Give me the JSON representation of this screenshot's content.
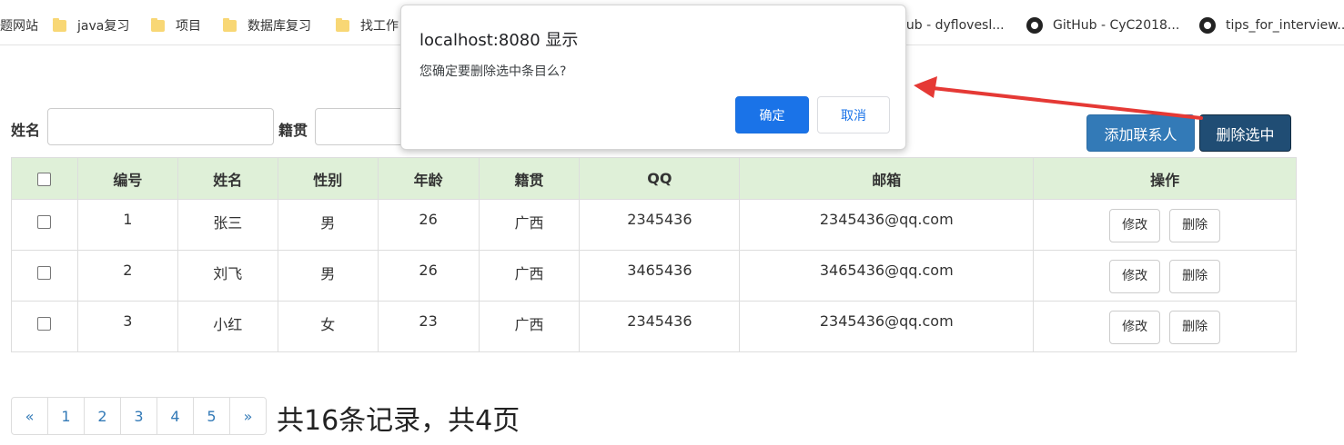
{
  "bookmarks": [
    {
      "label": "题网站",
      "icon": "none"
    },
    {
      "label": "java复习",
      "icon": "folder-icon"
    },
    {
      "label": "项目",
      "icon": "folder-icon"
    },
    {
      "label": "数据库复习",
      "icon": "folder-icon"
    },
    {
      "label": "找工作",
      "icon": "folder-icon"
    },
    {
      "label": "lub - dyflovesl...",
      "icon": "none"
    },
    {
      "label": "GitHub - CyC2018...",
      "icon": "github-icon"
    },
    {
      "label": "tips_for_interview...",
      "icon": "github-icon"
    }
  ],
  "search": {
    "name_label": "姓名",
    "native_label": "籍贯"
  },
  "actions": {
    "add_label": "添加联系人",
    "delete_selected_label": "删除选中"
  },
  "table": {
    "headers": [
      "编号",
      "姓名",
      "性别",
      "年龄",
      "籍贯",
      "QQ",
      "邮箱",
      "操作"
    ],
    "rows": [
      {
        "id": "1",
        "name": "张三",
        "gender": "男",
        "age": "26",
        "native": "广西",
        "qq": "2345436",
        "email": "2345436@qq.com"
      },
      {
        "id": "2",
        "name": "刘飞",
        "gender": "男",
        "age": "26",
        "native": "广西",
        "qq": "3465436",
        "email": "3465436@qq.com"
      },
      {
        "id": "3",
        "name": "小红",
        "gender": "女",
        "age": "23",
        "native": "广西",
        "qq": "2345436",
        "email": "2345436@qq.com"
      }
    ],
    "edit_label": "修改",
    "delete_label": "删除"
  },
  "pagination": {
    "prev": "«",
    "pages": [
      "1",
      "2",
      "3",
      "4",
      "5"
    ],
    "next": "»",
    "summary": "共16条记录，共4页"
  },
  "dialog": {
    "title": "localhost:8080 显示",
    "message": "您确定要删除选中条目么?",
    "ok_label": "确定",
    "cancel_label": "取消"
  },
  "colors": {
    "header_bg": "#dff0d8",
    "primary": "#337ab7",
    "danger_dark": "#204d74",
    "dialog_ok": "#1a73e8",
    "annotation_arrow": "#e53935"
  }
}
